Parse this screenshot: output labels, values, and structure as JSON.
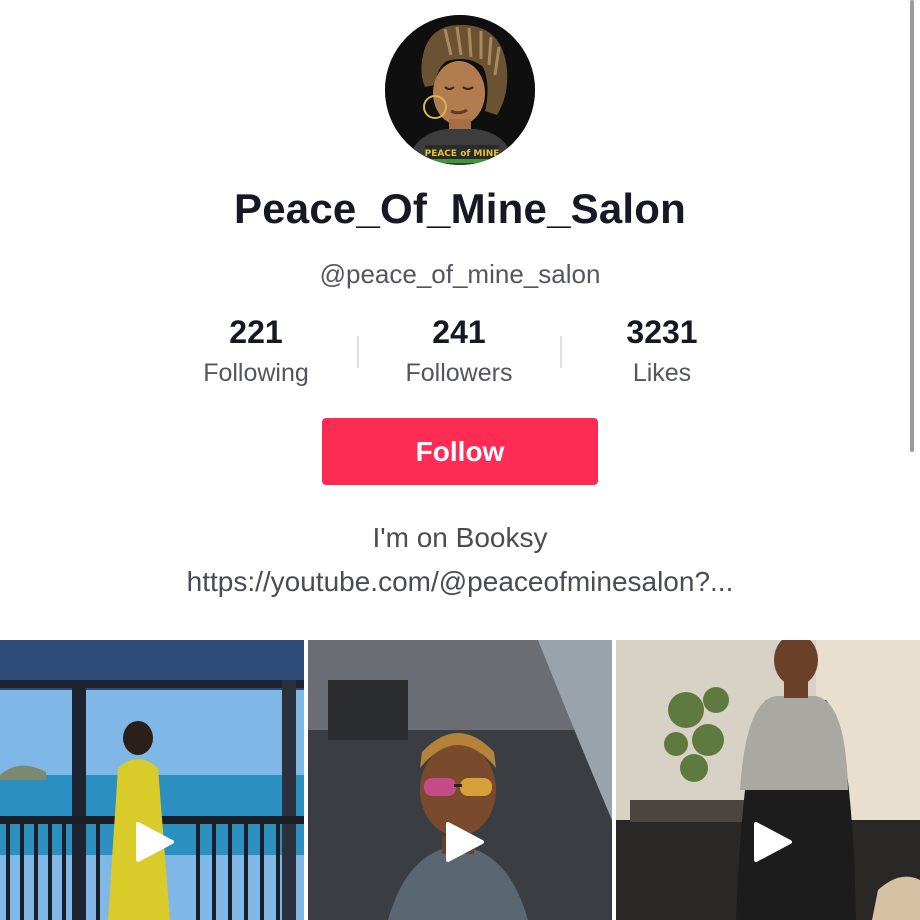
{
  "profile": {
    "display_name": "Peace_Of_Mine_Salon",
    "handle": "@peace_of_mine_salon",
    "avatar_shirt_text": "PEACE of MINE"
  },
  "stats": {
    "following": {
      "value": "221",
      "label": "Following"
    },
    "followers": {
      "value": "241",
      "label": "Followers"
    },
    "likes": {
      "value": "3231",
      "label": "Likes"
    }
  },
  "actions": {
    "follow_label": "Follow"
  },
  "bio": {
    "text": "I'm on Booksy",
    "link": "https://youtube.com/@peaceofminesalon?..."
  },
  "videos": [
    {
      "icon": "play-icon"
    },
    {
      "icon": "play-icon"
    },
    {
      "icon": "play-icon"
    }
  ],
  "colors": {
    "follow_button": "#fe2c55",
    "text_primary": "#161823",
    "text_secondary": "#545560"
  }
}
